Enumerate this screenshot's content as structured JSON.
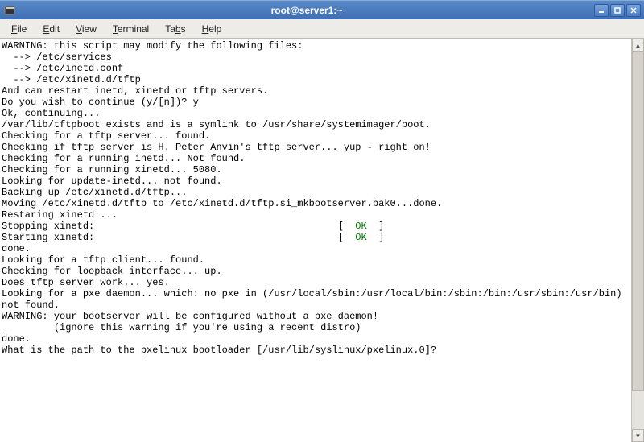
{
  "window": {
    "title": "root@server1:~"
  },
  "menu": {
    "file": "File",
    "edit": "Edit",
    "view": "View",
    "terminal": "Terminal",
    "tabs": "Tabs",
    "help": "Help"
  },
  "term": {
    "l0": "WARNING: this script may modify the following files:",
    "l1": "  --> /etc/services",
    "l2": "  --> /etc/inetd.conf",
    "l3": "  --> /etc/xinetd.d/tftp",
    "l4": "And can restart inetd, xinetd or tftp servers.",
    "l5": "Do you wish to continue (y/[n])? y",
    "l6": "Ok, continuing...",
    "l7": "/var/lib/tftpboot exists and is a symlink to /usr/share/systemimager/boot.",
    "l8": "Checking for a tftp server... found.",
    "l9": "Checking if tftp server is H. Peter Anvin's tftp server... yup - right on!",
    "l10": "Checking for a running inetd... Not found.",
    "l11": "Checking for a running xinetd... 5080.",
    "l12": "Looking for update-inetd... not found.",
    "l13": "Backing up /etc/xinetd.d/tftp...",
    "l14": "Moving /etc/xinetd.d/tftp to /etc/xinetd.d/tftp.si_mkbootserver.bak0...done.",
    "l15": "Restaring xinetd ...",
    "l16a": "Stopping xinetd:                                          [  ",
    "l16ok": "OK",
    "l16b": "  ]",
    "l17a": "Starting xinetd:                                          [  ",
    "l17ok": "OK",
    "l17b": "  ]",
    "l18": "done.",
    "l19": "Looking for a tftp client... found.",
    "l20": "Checking for loopback interface... up.",
    "l21": "Does tftp server work... yes.",
    "l22": "Looking for a pxe daemon... which: no pxe in (/usr/local/sbin:/usr/local/bin:/sbin:/bin:/usr/sbin:/usr/bin)",
    "l23": "not found.",
    "l24": "WARNING: your bootserver will be configured without a pxe daemon!",
    "l25": "         (ignore this warning if you're using a recent distro)",
    "l26": "done.",
    "l27": "What is the path to the pxelinux bootloader [/usr/lib/syslinux/pxelinux.0]?"
  }
}
